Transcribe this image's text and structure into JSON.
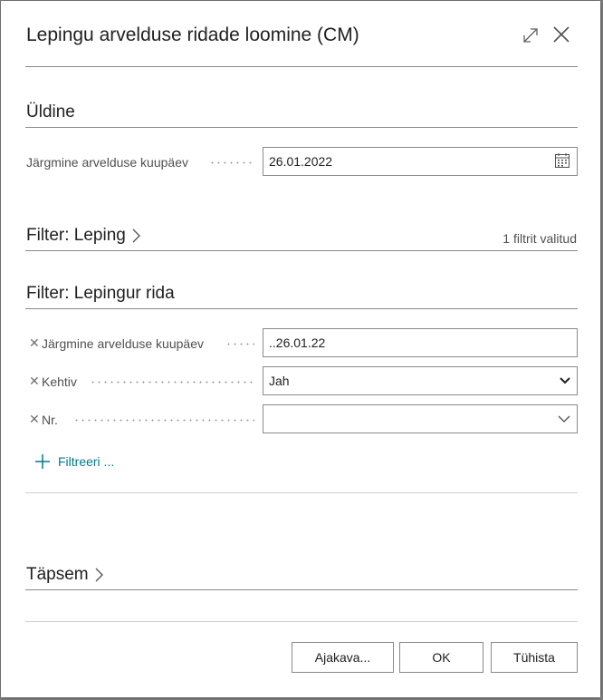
{
  "dialog": {
    "title": "Lepingu arvelduse ridade loomine (CM)",
    "expand_icon": "expand-icon",
    "close_icon": "close-icon"
  },
  "general": {
    "title": "Üldine",
    "next_billing_date_label": "Järgmine arvelduse kuupäev",
    "next_billing_date_value": "26.01.2022",
    "calendar_icon": "calendar-icon"
  },
  "filter_contract": {
    "title": "Filter: Leping",
    "filter_count": "1 filtrit valitud"
  },
  "filter_contract_line": {
    "title": "Filter: Lepingur rida",
    "rows": [
      {
        "label": "Järgmine arvelduse kuupäev",
        "value": "..26.01.22",
        "type": "text"
      },
      {
        "label": "Kehtiv",
        "value": "Jah",
        "type": "select"
      },
      {
        "label": "Nr.",
        "value": "",
        "type": "dropdown"
      }
    ],
    "add_filter_label": "Filtreeri ..."
  },
  "advanced": {
    "title": "Täpsem"
  },
  "footer": {
    "schedule_label": "Ajakava...",
    "ok_label": "OK",
    "cancel_label": "Tühista"
  },
  "colors": {
    "accent": "#007c89",
    "text": "#212121",
    "muted": "#505050"
  }
}
